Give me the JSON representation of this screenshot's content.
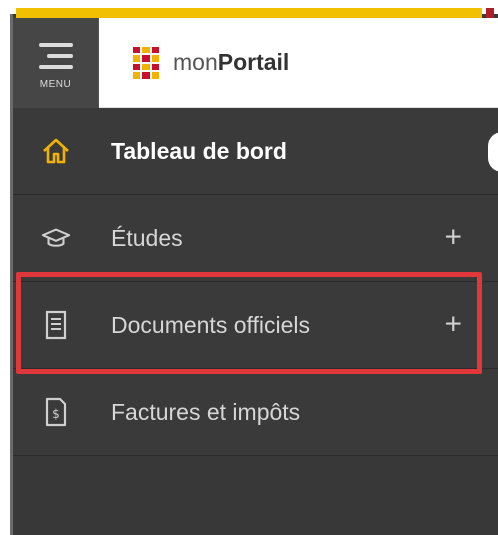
{
  "menu_label": "MENU",
  "brand": {
    "prefix": "mon",
    "name": "Portail"
  },
  "nav": {
    "items": [
      {
        "label": "Tableau de bord",
        "icon": "home-icon",
        "active": true
      },
      {
        "label": "Études",
        "icon": "graduation-cap-icon",
        "expandable": true
      },
      {
        "label": "Documents officiels",
        "icon": "document-icon",
        "expandable": true
      },
      {
        "label": "Factures et impôts",
        "icon": "invoice-icon"
      }
    ],
    "plus_symbol": "+"
  },
  "colors": {
    "sidebar": "#3a3a3a",
    "accent_yellow": "#f1c000",
    "highlight_red": "#e0383a",
    "home_icon": "#f1b300"
  }
}
